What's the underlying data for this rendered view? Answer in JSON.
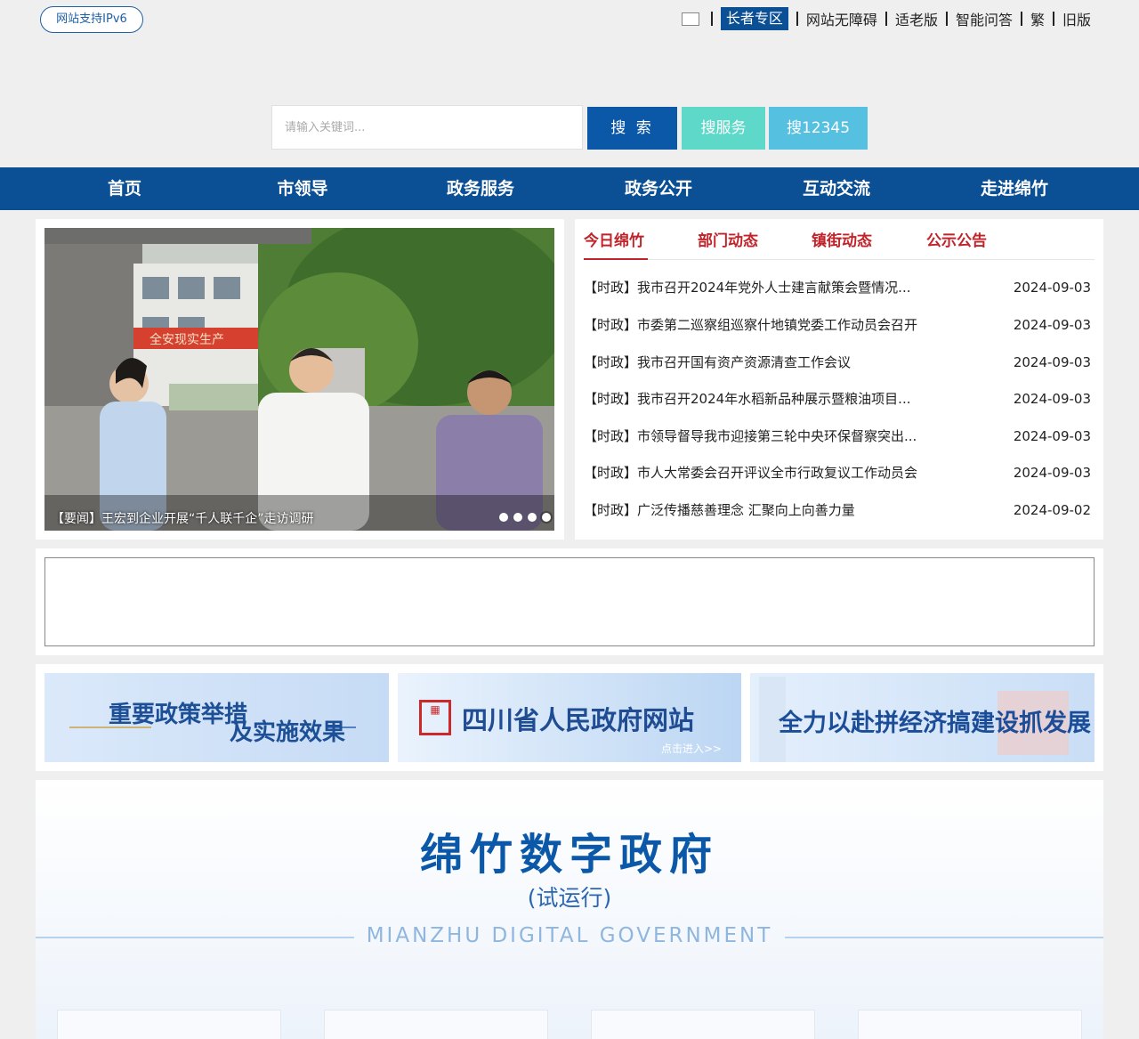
{
  "top": {
    "ipv6": "网站支持IPv6",
    "links": [
      "长者专区",
      "网站无障碍",
      "适老版",
      "智能问答",
      "繁",
      "旧版"
    ]
  },
  "search": {
    "placeholder": "请输入关键词...",
    "search_btn": "搜 索",
    "service_btn": "搜服务",
    "hotline_btn": "搜12345"
  },
  "nav": [
    "首页",
    "市领导",
    "政务服务",
    "政务公开",
    "互动交流",
    "走进绵竹"
  ],
  "slide": {
    "caption": "【要闻】王宏到企业开展“千人联千企”走访调研",
    "banner_text": "全安现实生产"
  },
  "tabs": [
    "今日绵竹",
    "部门动态",
    "镇街动态",
    "公示公告"
  ],
  "news": [
    {
      "title": "【时政】我市召开2024年党外人士建言献策会暨情况...",
      "date": "2024-09-03"
    },
    {
      "title": "【时政】市委第二巡察组巡察什地镇党委工作动员会召开",
      "date": "2024-09-03"
    },
    {
      "title": "【时政】我市召开国有资产资源清查工作会议",
      "date": "2024-09-03"
    },
    {
      "title": "【时政】我市召开2024年水稻新品种展示暨粮油项目...",
      "date": "2024-09-03"
    },
    {
      "title": "【时政】市领导督导我市迎接第三轮中央环保督察突出...",
      "date": "2024-09-03"
    },
    {
      "title": "【时政】市人大常委会召开评议全市行政复议工作动员会",
      "date": "2024-09-03"
    },
    {
      "title": "【时政】广泛传播慈善理念 汇聚向上向善力量",
      "date": "2024-09-02"
    }
  ],
  "banners": {
    "policy_line1": "重要政策举措",
    "policy_line2": "及实施效果",
    "province_title": "四川省人民政府网站",
    "province_enter": "点击进入>>",
    "economy": "全力以赴拼经济搞建设抓发展"
  },
  "digital": {
    "title": "绵竹数字政府",
    "subtitle": "(试运行)",
    "english": "MIANZHU DIGITAL GOVERNMENT"
  }
}
